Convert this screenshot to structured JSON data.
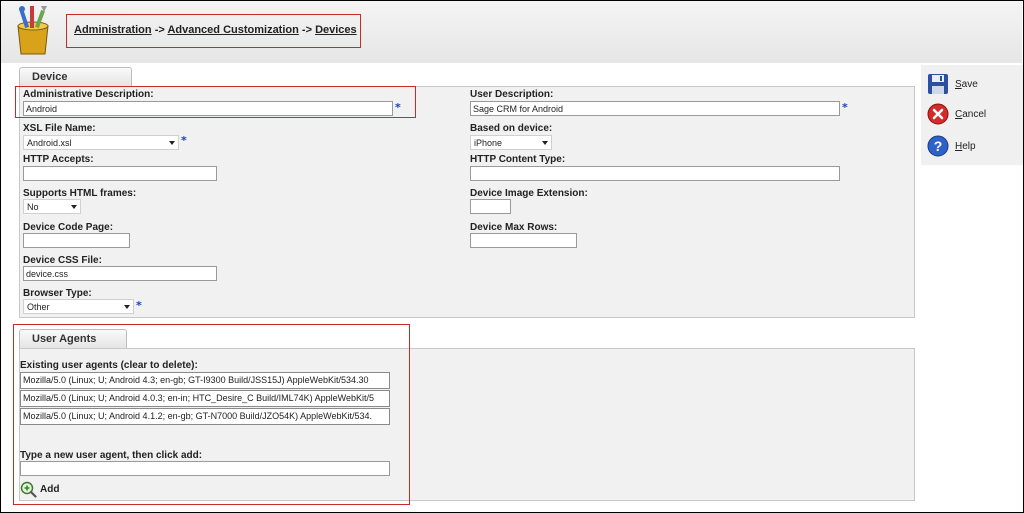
{
  "breadcrumb": {
    "items": [
      "Administration",
      "Advanced Customization",
      "Devices"
    ],
    "separator": "->"
  },
  "device_tab": {
    "label": "Device"
  },
  "fields": {
    "admin_description": {
      "label": "Administrative Description:",
      "value": "Android",
      "required": "*"
    },
    "user_description": {
      "label": "User Description:",
      "value": "Sage CRM for Android",
      "required": "*"
    },
    "xsl_file_name": {
      "label": "XSL File Name:",
      "value": "Android.xsl",
      "required": "*"
    },
    "based_on_device": {
      "label": "Based on device:",
      "value": "iPhone"
    },
    "http_accepts": {
      "label": "HTTP Accepts:",
      "value": ""
    },
    "http_content_type": {
      "label": "HTTP Content Type:",
      "value": ""
    },
    "supports_html_frames": {
      "label": "Supports HTML frames:",
      "value": "No"
    },
    "device_image_extension": {
      "label": "Device Image Extension:",
      "value": ""
    },
    "device_code_page": {
      "label": "Device Code Page:",
      "value": ""
    },
    "device_max_rows": {
      "label": "Device Max Rows:",
      "value": ""
    },
    "device_css_file": {
      "label": "Device CSS File:",
      "value": "device.css"
    },
    "browser_type": {
      "label": "Browser Type:",
      "value": "Other",
      "required": "*"
    }
  },
  "actions": {
    "save": "Save",
    "cancel": "Cancel",
    "help": "Help"
  },
  "user_agents": {
    "tab_label": "User Agents",
    "existing_label": "Existing user agents (clear to delete):",
    "rows": [
      "Mozilla/5.0 (Linux; U; Android 4.3; en-gb; GT-I9300 Build/JSS15J) AppleWebKit/534.30",
      "Mozilla/5.0 (Linux; U; Android 4.0.3; en-in; HTC_Desire_C Build/IML74K) AppleWebKit/5",
      "Mozilla/5.0 (Linux; U; Android 4.1.2; en-gb; GT-N7000 Build/JZO54K) AppleWebKit/534."
    ],
    "new_label": "Type a new user agent, then click add:",
    "new_value": "",
    "add_label": "Add"
  },
  "colors": {
    "highlight_box": "#cc2a2a",
    "required_marker": "#1a3fb8",
    "panel_bg": "#f1f1f1"
  }
}
